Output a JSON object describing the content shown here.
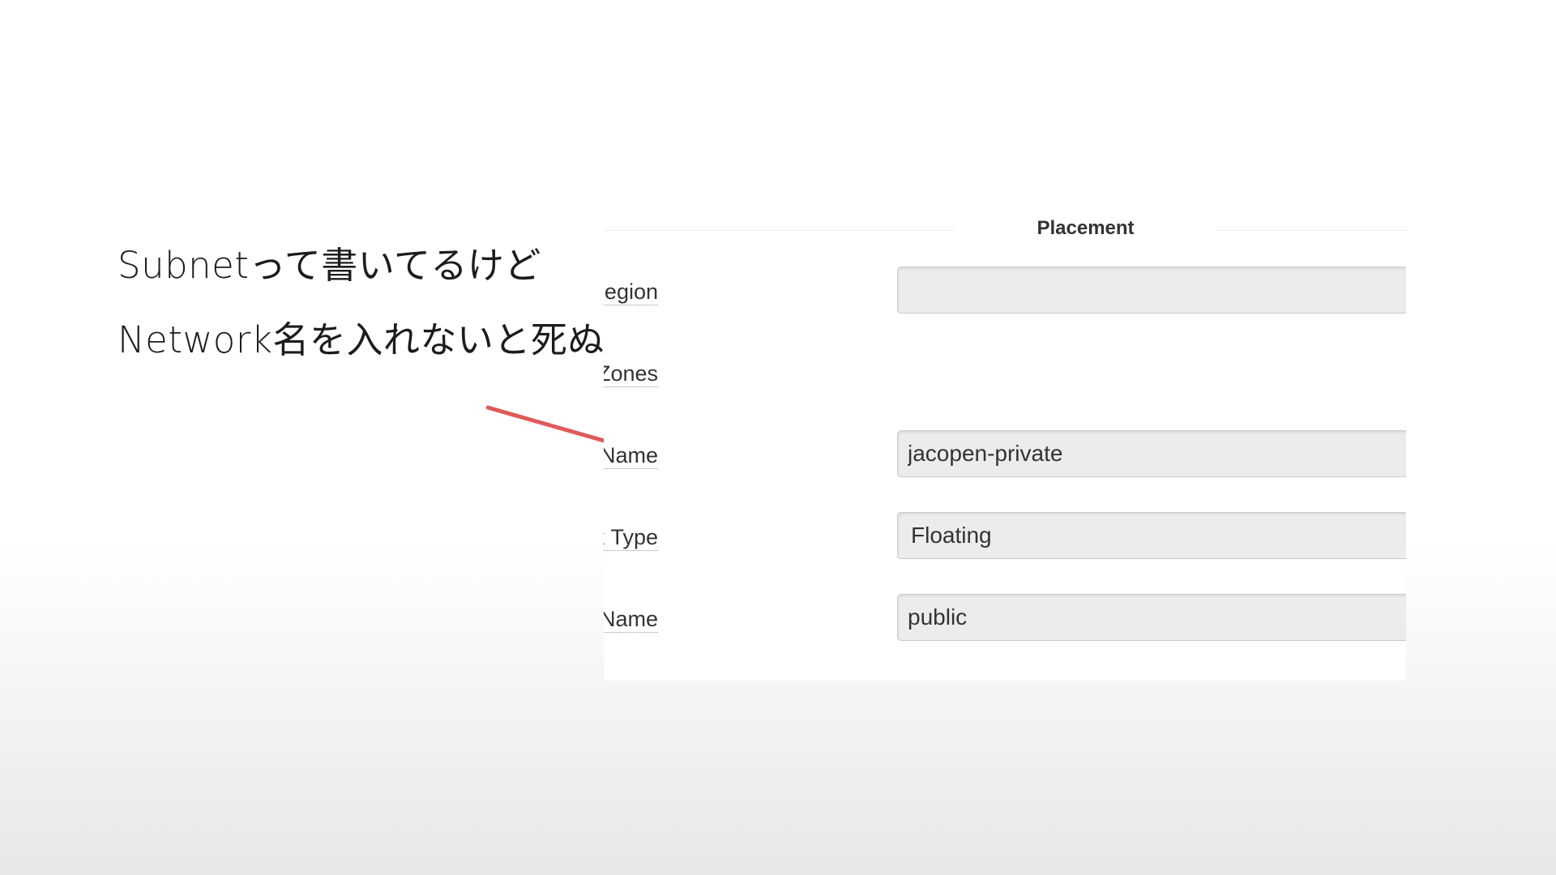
{
  "annotation": {
    "line1": "Subnetって書いてるけど",
    "line2": "Network名を入れないと死ぬ",
    "arrow_color": "#e05a5a"
  },
  "form": {
    "section_title": "Placement",
    "fields": [
      {
        "label": "Region",
        "value": ""
      },
      {
        "label": "Availability Zones"
      },
      {
        "label": "Subnet Name",
        "value": "jacopen-private"
      },
      {
        "label": "Public Network Type",
        "value": "Floating"
      },
      {
        "label": "Public Subnet Name",
        "value": "public"
      }
    ]
  }
}
